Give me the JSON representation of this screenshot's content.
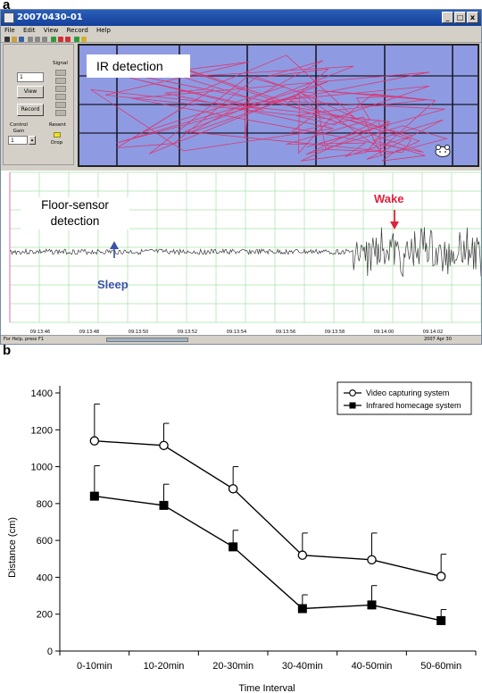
{
  "panels": {
    "a": "a",
    "b": "b"
  },
  "window": {
    "title": "20070430-01",
    "controls": [
      "_",
      "□",
      "x"
    ],
    "menu": [
      "File",
      "Edit",
      "View",
      "Record",
      "Help"
    ]
  },
  "control_panel": {
    "id_value": "1",
    "signal_label": "Signal",
    "view_button": "View",
    "record_button": "Record",
    "control_gain_label": "Control\nGain",
    "gain_value": "1",
    "resent_label": "Resent",
    "drop_label": "Drop"
  },
  "ir_panel": {
    "label": "IR detection"
  },
  "floor_panel": {
    "label": "Floor-sensor\ndetection",
    "wake_label": "Wake",
    "sleep_label": "Sleep",
    "time_ticks": [
      "09:13:46",
      "09:13:48",
      "09:13:50",
      "09:13:52",
      "09:13:54",
      "09:13:56",
      "09:13:58",
      "09:14:00",
      "09:14:02"
    ],
    "colors": {
      "grid": "#a8e0a8",
      "trace": "#3a3a3a",
      "wake": "#e0203c",
      "sleep": "#3a52a8"
    }
  },
  "statusbar": {
    "left": "For Help, press F1",
    "right": "2007 Apr 30"
  },
  "chart_data": {
    "type": "line",
    "categories": [
      "0-10min",
      "10-20min",
      "20-30min",
      "30-40min",
      "40-50min",
      "50-60min"
    ],
    "xlabel": "Time Interval",
    "ylabel": "Distance (cm)",
    "ylim": [
      0,
      1400
    ],
    "yticks": [
      0,
      200,
      400,
      600,
      800,
      1000,
      1200,
      1400
    ],
    "grid": false,
    "legend_position": "top-right",
    "series": [
      {
        "name": "Video capturing system",
        "marker": "open-circle",
        "values": [
          1140,
          1115,
          880,
          520,
          495,
          405
        ],
        "errors": [
          200,
          120,
          120,
          120,
          145,
          120
        ]
      },
      {
        "name": "Infrared homecage system",
        "marker": "filled-square",
        "values": [
          840,
          790,
          565,
          230,
          250,
          165
        ],
        "errors": [
          165,
          115,
          90,
          75,
          105,
          60
        ]
      }
    ]
  }
}
